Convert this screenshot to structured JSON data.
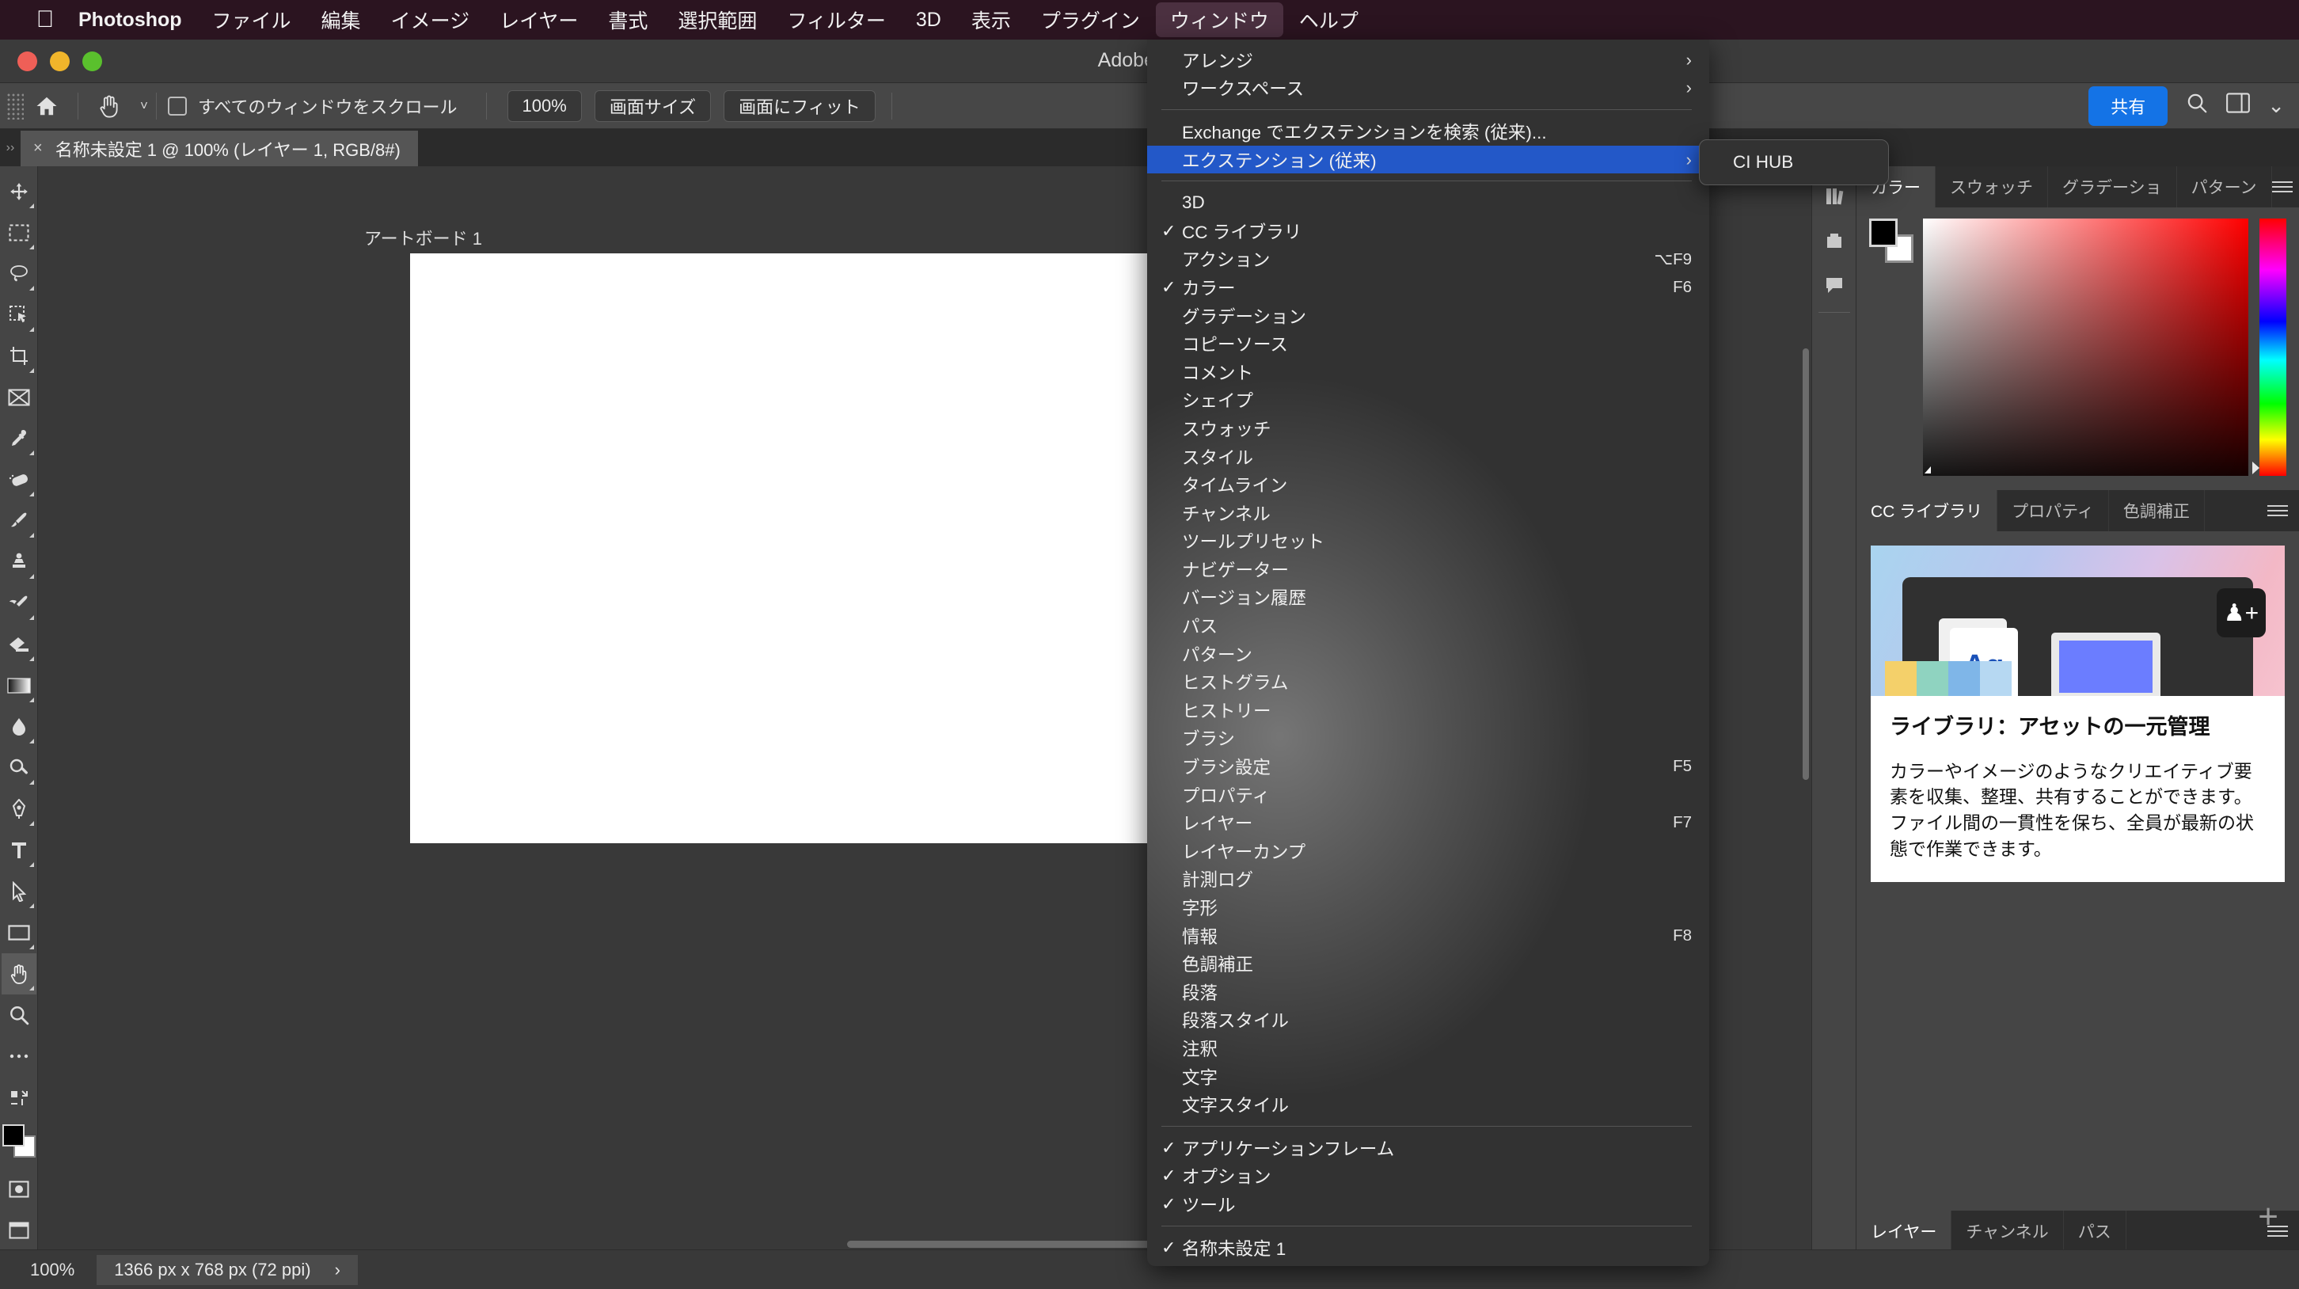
{
  "macmenu": {
    "apple_icon": "apple-logo",
    "items": [
      {
        "label": "Photoshop",
        "bold": true,
        "active": false
      },
      {
        "label": "ファイル",
        "bold": false,
        "active": false
      },
      {
        "label": "編集",
        "bold": false,
        "active": false
      },
      {
        "label": "イメージ",
        "bold": false,
        "active": false
      },
      {
        "label": "レイヤー",
        "bold": false,
        "active": false
      },
      {
        "label": "書式",
        "bold": false,
        "active": false
      },
      {
        "label": "選択範囲",
        "bold": false,
        "active": false
      },
      {
        "label": "フィルター",
        "bold": false,
        "active": false
      },
      {
        "label": "3D",
        "bold": false,
        "active": false
      },
      {
        "label": "表示",
        "bold": false,
        "active": false
      },
      {
        "label": "プラグイン",
        "bold": false,
        "active": false
      },
      {
        "label": "ウィンドウ",
        "bold": false,
        "active": true
      },
      {
        "label": "ヘルプ",
        "bold": false,
        "active": false
      }
    ]
  },
  "window": {
    "title": "Adobe Phot"
  },
  "options_bar": {
    "home_icon": "home-icon",
    "tool_icon": "hand-tool-icon",
    "tool_caret": "˅",
    "scroll_all_windows_label": "すべてのウィンドウをスクロール",
    "scroll_all_windows_checked": false,
    "zoom_100_label": "100%",
    "screen_size_label": "画面サイズ",
    "fit_screen_label": "画面にフィット",
    "share_label": "共有",
    "search_icon": "search-icon",
    "workspace_icon": "workspace-icon",
    "overflow_icon": "chevron-down-icon"
  },
  "document_tab": {
    "close_icon": "×",
    "title": "名称未設定 1 @ 100% (レイヤー 1, RGB/8#)"
  },
  "canvas": {
    "artboard_label": "アートボード 1"
  },
  "tools": [
    {
      "name": "move-tool",
      "has_submenu": true
    },
    {
      "name": "marquee-tool",
      "has_submenu": true
    },
    {
      "name": "lasso-tool",
      "has_submenu": true
    },
    {
      "name": "object-selection-tool",
      "has_submenu": true
    },
    {
      "name": "crop-tool",
      "has_submenu": true
    },
    {
      "name": "frame-tool",
      "has_submenu": false
    },
    {
      "name": "eyedropper-tool",
      "has_submenu": true
    },
    {
      "name": "healing-brush-tool",
      "has_submenu": true
    },
    {
      "name": "brush-tool",
      "has_submenu": true
    },
    {
      "name": "clone-stamp-tool",
      "has_submenu": true
    },
    {
      "name": "history-brush-tool",
      "has_submenu": true
    },
    {
      "name": "eraser-tool",
      "has_submenu": true
    },
    {
      "name": "gradient-tool",
      "has_submenu": true
    },
    {
      "name": "blur-tool",
      "has_submenu": true
    },
    {
      "name": "dodge-tool",
      "has_submenu": true
    },
    {
      "name": "pen-tool",
      "has_submenu": true
    },
    {
      "name": "type-tool",
      "has_submenu": true
    },
    {
      "name": "path-selection-tool",
      "has_submenu": true
    },
    {
      "name": "rectangle-tool",
      "has_submenu": true
    },
    {
      "name": "hand-tool",
      "has_submenu": true,
      "selected": true
    },
    {
      "name": "zoom-tool",
      "has_submenu": false
    },
    {
      "name": "more-tools",
      "has_submenu": false
    }
  ],
  "menu": {
    "title": "ウィンドウ",
    "sections": [
      {
        "items": [
          {
            "label": "アレンジ",
            "checked": false,
            "shortcut": "",
            "submenu": true,
            "highlighted": false
          },
          {
            "label": "ワークスペース",
            "checked": false,
            "shortcut": "",
            "submenu": true,
            "highlighted": false
          }
        ]
      },
      {
        "items": [
          {
            "label": "Exchange でエクステンションを検索 (従来)...",
            "checked": false,
            "shortcut": "",
            "submenu": false,
            "highlighted": false
          },
          {
            "label": "エクステンション (従来)",
            "checked": false,
            "shortcut": "",
            "submenu": true,
            "highlighted": true
          }
        ]
      },
      {
        "items": [
          {
            "label": "3D",
            "checked": false,
            "shortcut": "",
            "submenu": false,
            "highlighted": false
          },
          {
            "label": "CC ライブラリ",
            "checked": true,
            "shortcut": "",
            "submenu": false,
            "highlighted": false
          },
          {
            "label": "アクション",
            "checked": false,
            "shortcut": "⌥F9",
            "submenu": false,
            "highlighted": false
          },
          {
            "label": "カラー",
            "checked": true,
            "shortcut": "F6",
            "submenu": false,
            "highlighted": false
          },
          {
            "label": "グラデーション",
            "checked": false,
            "shortcut": "",
            "submenu": false,
            "highlighted": false
          },
          {
            "label": "コピーソース",
            "checked": false,
            "shortcut": "",
            "submenu": false,
            "highlighted": false
          },
          {
            "label": "コメント",
            "checked": false,
            "shortcut": "",
            "submenu": false,
            "highlighted": false
          },
          {
            "label": "シェイプ",
            "checked": false,
            "shortcut": "",
            "submenu": false,
            "highlighted": false
          },
          {
            "label": "スウォッチ",
            "checked": false,
            "shortcut": "",
            "submenu": false,
            "highlighted": false
          },
          {
            "label": "スタイル",
            "checked": false,
            "shortcut": "",
            "submenu": false,
            "highlighted": false
          },
          {
            "label": "タイムライン",
            "checked": false,
            "shortcut": "",
            "submenu": false,
            "highlighted": false
          },
          {
            "label": "チャンネル",
            "checked": false,
            "shortcut": "",
            "submenu": false,
            "highlighted": false
          },
          {
            "label": "ツールプリセット",
            "checked": false,
            "shortcut": "",
            "submenu": false,
            "highlighted": false
          },
          {
            "label": "ナビゲーター",
            "checked": false,
            "shortcut": "",
            "submenu": false,
            "highlighted": false
          },
          {
            "label": "バージョン履歴",
            "checked": false,
            "shortcut": "",
            "submenu": false,
            "highlighted": false
          },
          {
            "label": "パス",
            "checked": false,
            "shortcut": "",
            "submenu": false,
            "highlighted": false
          },
          {
            "label": "パターン",
            "checked": false,
            "shortcut": "",
            "submenu": false,
            "highlighted": false
          },
          {
            "label": "ヒストグラム",
            "checked": false,
            "shortcut": "",
            "submenu": false,
            "highlighted": false
          },
          {
            "label": "ヒストリー",
            "checked": false,
            "shortcut": "",
            "submenu": false,
            "highlighted": false
          },
          {
            "label": "ブラシ",
            "checked": false,
            "shortcut": "",
            "submenu": false,
            "highlighted": false
          },
          {
            "label": "ブラシ設定",
            "checked": false,
            "shortcut": "F5",
            "submenu": false,
            "highlighted": false
          },
          {
            "label": "プロパティ",
            "checked": false,
            "shortcut": "",
            "submenu": false,
            "highlighted": false
          },
          {
            "label": "レイヤー",
            "checked": false,
            "shortcut": "F7",
            "submenu": false,
            "highlighted": false
          },
          {
            "label": "レイヤーカンプ",
            "checked": false,
            "shortcut": "",
            "submenu": false,
            "highlighted": false
          },
          {
            "label": "計測ログ",
            "checked": false,
            "shortcut": "",
            "submenu": false,
            "highlighted": false
          },
          {
            "label": "字形",
            "checked": false,
            "shortcut": "",
            "submenu": false,
            "highlighted": false
          },
          {
            "label": "情報",
            "checked": false,
            "shortcut": "F8",
            "submenu": false,
            "highlighted": false
          },
          {
            "label": "色調補正",
            "checked": false,
            "shortcut": "",
            "submenu": false,
            "highlighted": false
          },
          {
            "label": "段落",
            "checked": false,
            "shortcut": "",
            "submenu": false,
            "highlighted": false
          },
          {
            "label": "段落スタイル",
            "checked": false,
            "shortcut": "",
            "submenu": false,
            "highlighted": false
          },
          {
            "label": "注釈",
            "checked": false,
            "shortcut": "",
            "submenu": false,
            "highlighted": false
          },
          {
            "label": "文字",
            "checked": false,
            "shortcut": "",
            "submenu": false,
            "highlighted": false
          },
          {
            "label": "文字スタイル",
            "checked": false,
            "shortcut": "",
            "submenu": false,
            "highlighted": false
          }
        ]
      },
      {
        "items": [
          {
            "label": "アプリケーションフレーム",
            "checked": true,
            "shortcut": "",
            "submenu": false,
            "highlighted": false
          },
          {
            "label": "オプション",
            "checked": true,
            "shortcut": "",
            "submenu": false,
            "highlighted": false
          },
          {
            "label": "ツール",
            "checked": true,
            "shortcut": "",
            "submenu": false,
            "highlighted": false
          }
        ]
      },
      {
        "items": [
          {
            "label": "名称未設定 1",
            "checked": true,
            "shortcut": "",
            "submenu": false,
            "highlighted": false
          }
        ]
      }
    ]
  },
  "submenu": {
    "items": [
      {
        "label": "CI HUB"
      }
    ]
  },
  "color_panel": {
    "tabs": [
      {
        "label": "カラー",
        "active": true
      },
      {
        "label": "スウォッチ",
        "active": false
      },
      {
        "label": "グラデーショ",
        "active": false
      },
      {
        "label": "パターン",
        "active": false
      }
    ],
    "menu_icon": "hamburger-icon",
    "foreground_color": "#000000",
    "background_color": "#ffffff"
  },
  "library_panel": {
    "tabs": [
      {
        "label": "CC ライブラリ",
        "active": true
      },
      {
        "label": "プロパティ",
        "active": false
      },
      {
        "label": "色調補正",
        "active": false
      }
    ],
    "menu_icon": "hamburger-icon",
    "card_title": "ライブラリ：アセットの一元管理",
    "card_body": "カラーやイメージのようなクリエイティブ要素を収集、整理、共有することができます。ファイル間の一貫性を保ち、全員が最新の状態で作業できます。",
    "card_badge_text": "Ag",
    "add_icon": "plus-icon"
  },
  "layers_panel": {
    "tabs": [
      {
        "label": "レイヤー",
        "active": true
      },
      {
        "label": "チャンネル",
        "active": false
      },
      {
        "label": "パス",
        "active": false
      }
    ],
    "menu_icon": "hamburger-icon"
  },
  "rail_icons": [
    {
      "name": "library-icon"
    },
    {
      "name": "swatch-icon"
    },
    {
      "name": "comment-icon"
    }
  ],
  "status_bar": {
    "zoom": "100%",
    "doc_size": "1366 px x 768 px (72 ppi)",
    "expand_icon": "›"
  },
  "colors": {
    "accent": "#1473e6",
    "menu_highlight": "#2358c8",
    "menubar_bg": "#2b1420",
    "panel_bg": "#454545",
    "app_bg": "#393939"
  }
}
